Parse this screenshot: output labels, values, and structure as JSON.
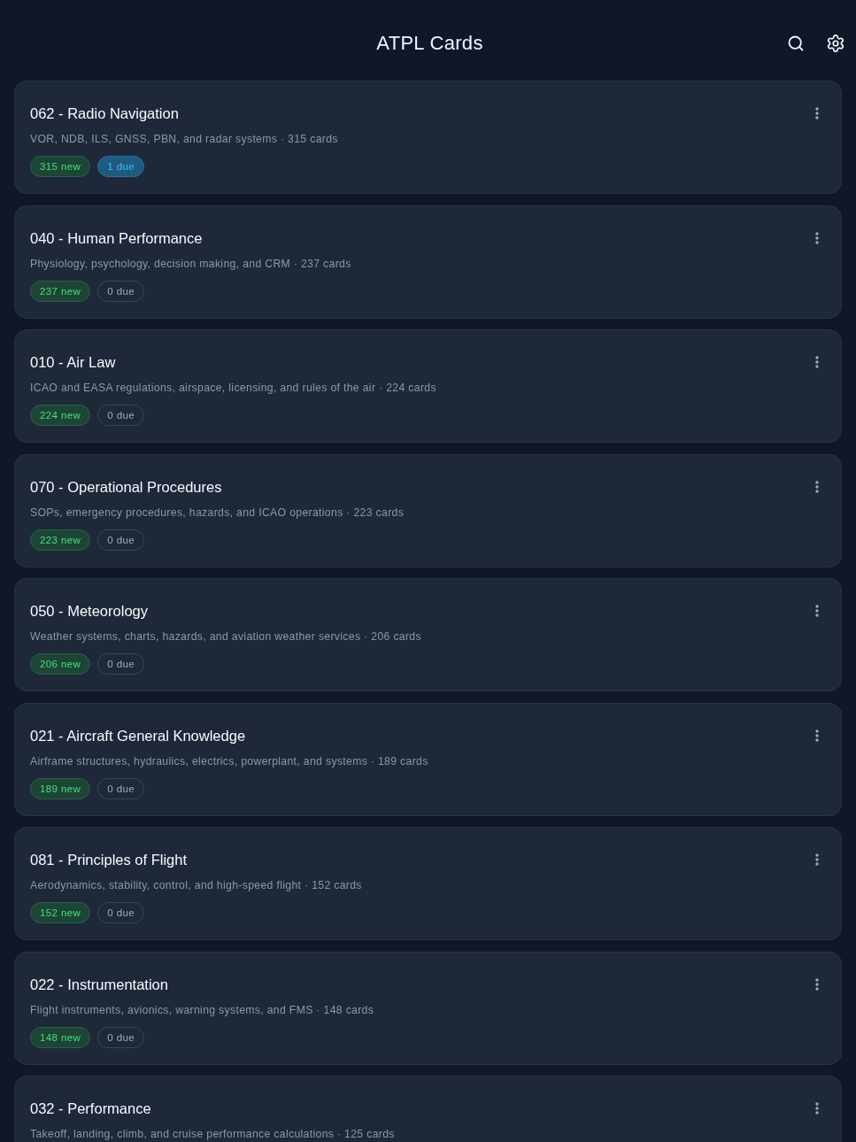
{
  "header": {
    "title": "ATPL Cards"
  },
  "decks": [
    {
      "title": "062 - Radio Navigation",
      "description": "VOR, NDB, ILS, GNSS, PBN, and radar systems · 315 cards",
      "new_badge": "315 new",
      "due_badge": {
        "label": "1 due",
        "active": true
      }
    },
    {
      "title": "040 - Human Performance",
      "description": "Physiology, psychology, decision making, and CRM · 237 cards",
      "new_badge": "237 new",
      "due_badge": {
        "label": "0 due",
        "active": false
      }
    },
    {
      "title": "010 - Air Law",
      "description": "ICAO and EASA regulations, airspace, licensing, and rules of the air · 224 cards",
      "new_badge": "224 new",
      "due_badge": {
        "label": "0 due",
        "active": false
      }
    },
    {
      "title": "070 - Operational Procedures",
      "description": "SOPs, emergency procedures, hazards, and ICAO operations · 223 cards",
      "new_badge": "223 new",
      "due_badge": {
        "label": "0 due",
        "active": false
      }
    },
    {
      "title": "050 - Meteorology",
      "description": "Weather systems, charts, hazards, and aviation weather services · 206 cards",
      "new_badge": "206 new",
      "due_badge": {
        "label": "0 due",
        "active": false
      }
    },
    {
      "title": "021 - Aircraft General Knowledge",
      "description": "Airframe structures, hydraulics, electrics, powerplant, and systems · 189 cards",
      "new_badge": "189 new",
      "due_badge": {
        "label": "0 due",
        "active": false
      }
    },
    {
      "title": "081 - Principles of Flight",
      "description": "Aerodynamics, stability, control, and high-speed flight · 152 cards",
      "new_badge": "152 new",
      "due_badge": {
        "label": "0 due",
        "active": false
      }
    },
    {
      "title": "022 - Instrumentation",
      "description": "Flight instruments, avionics, warning systems, and FMS · 148 cards",
      "new_badge": "148 new",
      "due_badge": {
        "label": "0 due",
        "active": false
      }
    },
    {
      "title": "032 - Performance",
      "description": "Takeoff, landing, climb, and cruise performance calculations · 125 cards"
    }
  ]
}
